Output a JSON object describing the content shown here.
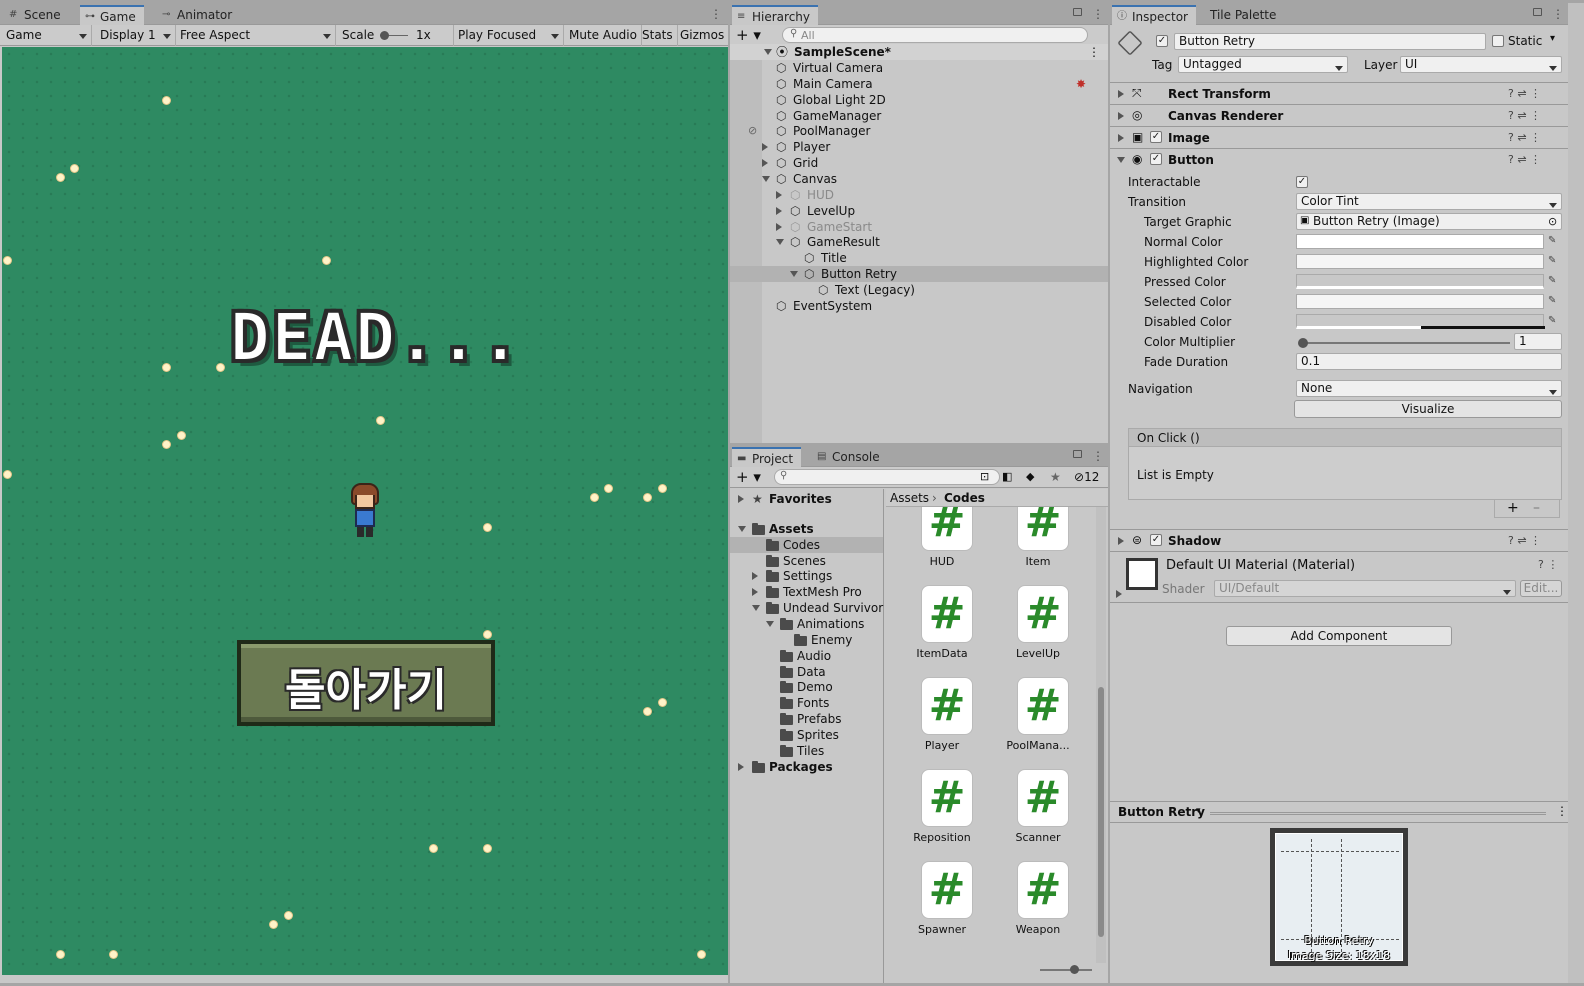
{
  "game_panel": {
    "tabs": [
      {
        "label": "Scene",
        "icon": "grid-icon"
      },
      {
        "label": "Game",
        "icon": "gamepad-icon"
      },
      {
        "label": "Animator",
        "icon": "animator-icon"
      }
    ],
    "toolbar": {
      "view": "Game",
      "display": "Display 1",
      "aspect": "Free Aspect",
      "scale_label": "Scale",
      "scale_value": "1x",
      "play_mode": "Play Focused",
      "mute": "Mute Audio",
      "stats": "Stats",
      "gizmos": "Gizmos"
    },
    "title_text": "DEAD...",
    "retry_text": "돌아가기"
  },
  "hierarchy": {
    "title": "Hierarchy",
    "search_placeholder": "All",
    "scene": "SampleScene*",
    "items": [
      {
        "label": "Virtual Camera"
      },
      {
        "label": "Main Camera"
      },
      {
        "label": "Global Light 2D"
      },
      {
        "label": "GameManager"
      },
      {
        "label": "PoolManager"
      },
      {
        "label": "Player"
      },
      {
        "label": "Grid"
      },
      {
        "label": "Canvas"
      },
      {
        "label": "HUD"
      },
      {
        "label": "LevelUp"
      },
      {
        "label": "GameStart"
      },
      {
        "label": "GameResult"
      },
      {
        "label": "Title"
      },
      {
        "label": "Button Retry"
      },
      {
        "label": "Text (Legacy)"
      },
      {
        "label": "EventSystem"
      }
    ]
  },
  "project": {
    "tabs": [
      {
        "label": "Project"
      },
      {
        "label": "Console"
      }
    ],
    "hidden_count": "12",
    "tree": [
      {
        "label": "Favorites"
      },
      {
        "label": "Assets"
      },
      {
        "label": "Codes"
      },
      {
        "label": "Scenes"
      },
      {
        "label": "Settings"
      },
      {
        "label": "TextMesh Pro"
      },
      {
        "label": "Undead Survivor"
      },
      {
        "label": "Animations"
      },
      {
        "label": "Enemy"
      },
      {
        "label": "Audio"
      },
      {
        "label": "Data"
      },
      {
        "label": "Demo"
      },
      {
        "label": "Fonts"
      },
      {
        "label": "Prefabs"
      },
      {
        "label": "Sprites"
      },
      {
        "label": "Tiles"
      },
      {
        "label": "Packages"
      }
    ],
    "breadcrumb": [
      "Assets",
      "Codes"
    ],
    "assets": [
      {
        "label": "HUD"
      },
      {
        "label": "Item"
      },
      {
        "label": "ItemData"
      },
      {
        "label": "LevelUp"
      },
      {
        "label": "Player"
      },
      {
        "label": "PoolMana..."
      },
      {
        "label": "Reposition"
      },
      {
        "label": "Scanner"
      },
      {
        "label": "Spawner"
      },
      {
        "label": "Weapon"
      }
    ],
    "script_glyph": "#"
  },
  "inspector": {
    "tabs": [
      {
        "label": "Inspector"
      },
      {
        "label": "Tile Palette"
      }
    ],
    "object_name": "Button Retry",
    "static_label": "Static",
    "tag_label": "Tag",
    "tag_value": "Untagged",
    "layer_label": "Layer",
    "layer_value": "UI",
    "components": [
      {
        "label": "Rect Transform"
      },
      {
        "label": "Canvas Renderer"
      },
      {
        "label": "Image"
      },
      {
        "label": "Button"
      }
    ],
    "button_props": {
      "interactable": "Interactable",
      "transition": "Transition",
      "transition_value": "Color Tint",
      "target_graphic": "Target Graphic",
      "target_graphic_value": "Button Retry (Image)",
      "normal": "Normal Color",
      "highlighted": "Highlighted Color",
      "pressed": "Pressed Color",
      "selected": "Selected Color",
      "disabled": "Disabled Color",
      "multiplier": "Color Multiplier",
      "multiplier_value": "1",
      "fade": "Fade Duration",
      "fade_value": "0.1",
      "navigation": "Navigation",
      "navigation_value": "None",
      "visualize": "Visualize",
      "onclick": "On Click ()",
      "empty": "List is Empty"
    },
    "shadow": "Shadow",
    "material_name": "Default UI Material (Material)",
    "shader_label": "Shader",
    "shader_value": "UI/Default",
    "edit": "Edit...",
    "add_component": "Add Component",
    "preview_title": "Button Retry",
    "preview_caption_1": "Button Retry",
    "preview_caption_2": "Image Size: 18x18"
  },
  "colors": {
    "grass": "#2e8a62",
    "selection": "#b2b2b2",
    "accent": "#3a72b0",
    "script_hash": "#2a8a2a"
  }
}
